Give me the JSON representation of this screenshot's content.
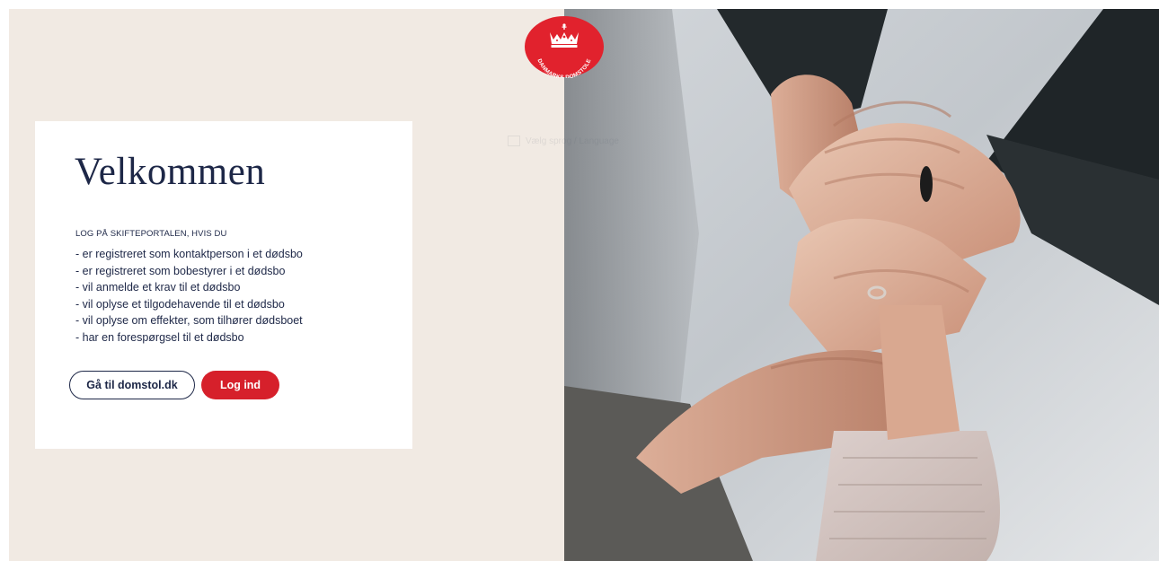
{
  "brand": {
    "logo_text": "DANMARKS DOMSTOLE",
    "primary_color": "#d6202b",
    "navy_color": "#1d2747",
    "background_color": "#f1eae3"
  },
  "card": {
    "title": "Velkommen",
    "intro": "LOG PÅ SKIFTEPORTALEN, HVIS DU",
    "items": [
      "- er registreret som kontaktperson i et dødsbo",
      "- er registreret som bobestyrer i et dødsbo",
      "- vil anmelde et krav til et dødsbo",
      "- vil oplyse et tilgodehavende til et dødsbo",
      "- vil oplyse om effekter, som tilhører dødsboet",
      "- har en forespørgsel til et dødsbo"
    ]
  },
  "buttons": {
    "domstol_label": "Gå til domstol.dk",
    "login_label": "Log ind"
  },
  "background_label": "Vælg sprog / Language",
  "hero_image": {
    "icon": "holding-hands-photo"
  }
}
